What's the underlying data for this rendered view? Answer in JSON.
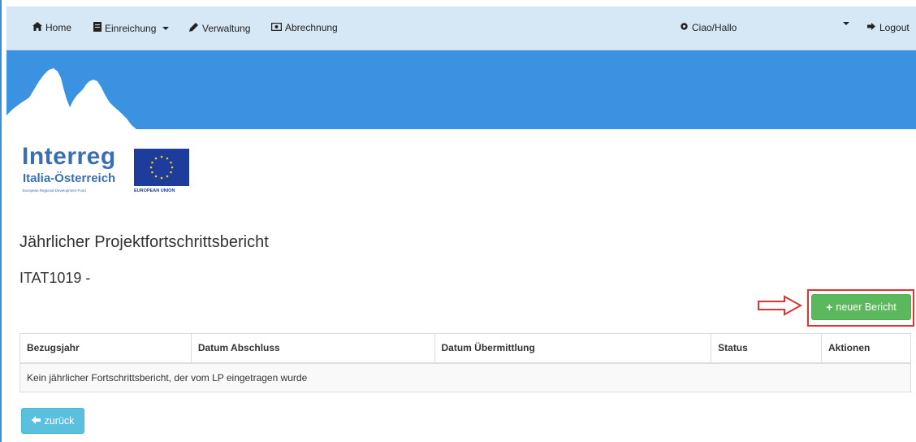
{
  "nav": {
    "home": {
      "label": "Home",
      "icon": "home-icon"
    },
    "einreichung": {
      "label": "Einreichung",
      "icon": "document-icon"
    },
    "verwaltung": {
      "label": "Verwaltung",
      "icon": "pencil-icon"
    },
    "abrechnung": {
      "label": "Abrechnung",
      "icon": "banknote-icon"
    },
    "user": {
      "label": "Ciao/Hallo",
      "icon": "gear-icon"
    },
    "logout": {
      "label": "Logout",
      "icon": "logout-icon"
    }
  },
  "logo": {
    "title": "Interreg",
    "subtitle": "Italia-Österreich",
    "tagline": "European Regional Development Fund",
    "eu_label": "EUROPEAN UNION"
  },
  "page": {
    "title": "Jährlicher Projektfortschrittsbericht",
    "project_code": "ITAT1019 -"
  },
  "actions": {
    "new_report_label": "neuer Bericht",
    "back_label": "zurück"
  },
  "table": {
    "columns": [
      "Bezugsjahr",
      "Datum Abschluss",
      "Datum Übermittlung",
      "Status",
      "Aktionen"
    ],
    "empty_message": "Kein jährlicher Fortschrittsbericht, der vom LP eingetragen wurde"
  },
  "colors": {
    "navbar_bg": "#d6e7f6",
    "banner_bg": "#3a92e1",
    "success_button": "#5cb85c",
    "info_button": "#5bc0de",
    "highlight": "#e23333"
  }
}
